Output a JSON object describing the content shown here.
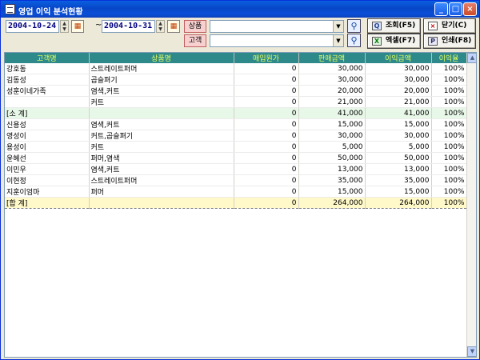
{
  "window": {
    "title": "영업 이익 분석현황"
  },
  "filters": {
    "date_from": "2004-10-24",
    "date_to": "2004-10-31",
    "separator": "~",
    "product_label": "상품",
    "customer_label": "고객",
    "product_value": "",
    "customer_value": ""
  },
  "actions": {
    "query": "조회(F5)",
    "close": "닫기(C)",
    "excel": "엑셀(F7)",
    "print": "인쇄(F8)"
  },
  "table": {
    "columns": [
      "고객명",
      "상품명",
      "매입원가",
      "판매금액",
      "이익금액",
      "이익율"
    ],
    "rows": [
      {
        "type": "row",
        "cells": [
          "강호동",
          "스트레이트퍼머",
          "0",
          "30,000",
          "30,000",
          "100%"
        ]
      },
      {
        "type": "row",
        "cells": [
          "김동성",
          "곱슬펴기",
          "0",
          "30,000",
          "30,000",
          "100%"
        ]
      },
      {
        "type": "row",
        "cells": [
          "성훈이네가족",
          "염색,커트",
          "0",
          "20,000",
          "20,000",
          "100%"
        ]
      },
      {
        "type": "row",
        "cells": [
          "",
          "커트",
          "0",
          "21,000",
          "21,000",
          "100%"
        ]
      },
      {
        "type": "subtotal",
        "cells": [
          "[소 계]",
          "",
          "0",
          "41,000",
          "41,000",
          "100%"
        ]
      },
      {
        "type": "row",
        "cells": [
          "신용성",
          "염색,커트",
          "0",
          "15,000",
          "15,000",
          "100%"
        ]
      },
      {
        "type": "row",
        "cells": [
          "영성이",
          "커트,곱슬펴기",
          "0",
          "30,000",
          "30,000",
          "100%"
        ]
      },
      {
        "type": "row",
        "cells": [
          "용성이",
          "커트",
          "0",
          "5,000",
          "5,000",
          "100%"
        ]
      },
      {
        "type": "row",
        "cells": [
          "윤혜선",
          "퍼머,염색",
          "0",
          "50,000",
          "50,000",
          "100%"
        ]
      },
      {
        "type": "row",
        "cells": [
          "이민우",
          "염색,커트",
          "0",
          "13,000",
          "13,000",
          "100%"
        ]
      },
      {
        "type": "row",
        "cells": [
          "이현정",
          "스트레이트퍼머",
          "0",
          "35,000",
          "35,000",
          "100%"
        ]
      },
      {
        "type": "row",
        "cells": [
          "지훈이엄마",
          "퍼머",
          "0",
          "15,000",
          "15,000",
          "100%"
        ]
      },
      {
        "type": "total",
        "cells": [
          "[합 계]",
          "",
          "0",
          "264,000",
          "264,000",
          "100%"
        ]
      }
    ]
  }
}
